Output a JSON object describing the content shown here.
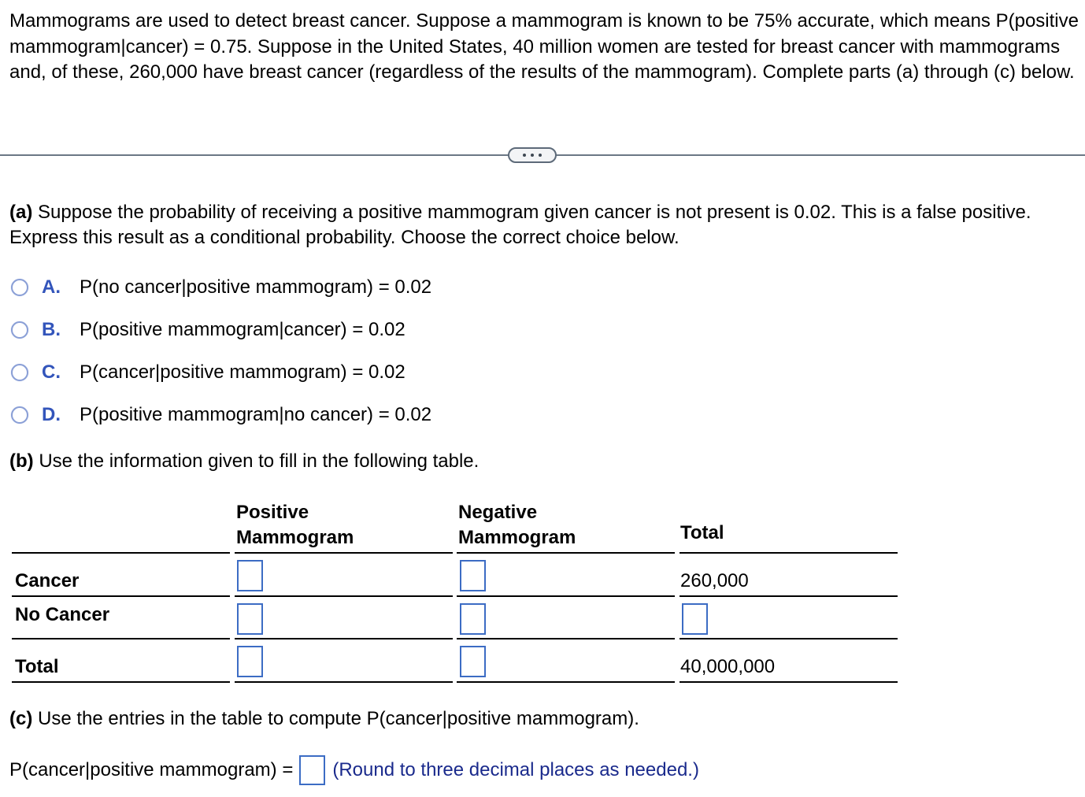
{
  "intro": {
    "text": "Mammograms are used to detect breast cancer. Suppose a mammogram is known to be 75% accurate, which means P(positive mammogram|cancer) = 0.75. Suppose in the United States, 40 million women are tested for breast cancer with mammograms and, of these, 260,000 have breast cancer (regardless of the results of the mammogram). Complete parts (a) through (c) below."
  },
  "divider": {
    "more_icon": "ellipsis-icon"
  },
  "part_a": {
    "label": "(a)",
    "text": " Suppose the probability of receiving a positive mammogram given cancer is not present is 0.02. This is a false positive. Express this result as a conditional probability. Choose the correct choice below.",
    "choices": [
      {
        "letter": "A.",
        "text": "P(no cancer|positive mammogram) = 0.02"
      },
      {
        "letter": "B.",
        "text": "P(positive mammogram|cancer) = 0.02"
      },
      {
        "letter": "C.",
        "text": "P(cancer|positive mammogram) = 0.02"
      },
      {
        "letter": "D.",
        "text": "P(positive mammogram|no cancer) = 0.02"
      }
    ]
  },
  "part_b": {
    "label": "(b)",
    "text": " Use the information given to fill in the following table.",
    "table": {
      "headers": {
        "positive_line1": "Positive",
        "positive_line2": "Mammogram",
        "negative_line1": "Negative",
        "negative_line2": "Mammogram",
        "total": "Total"
      },
      "rows": [
        {
          "label": "Cancer",
          "positive": "",
          "negative": "",
          "total": "260,000"
        },
        {
          "label": "No Cancer",
          "positive": "",
          "negative": "",
          "total": ""
        },
        {
          "label": "Total",
          "positive": "",
          "negative": "",
          "total": "40,000,000"
        }
      ]
    }
  },
  "part_c": {
    "label": "(c)",
    "text": " Use the entries in the table to compute P(cancer|positive mammogram).",
    "answer_label": "P(cancer|positive mammogram) =",
    "answer_value": "",
    "hint": "(Round to three decimal places as needed.)"
  },
  "colors": {
    "choice_letter": "#3355bb",
    "input_border": "#3c6cc4",
    "hint_text": "#1a2a8c",
    "divider": "#6b7785"
  }
}
